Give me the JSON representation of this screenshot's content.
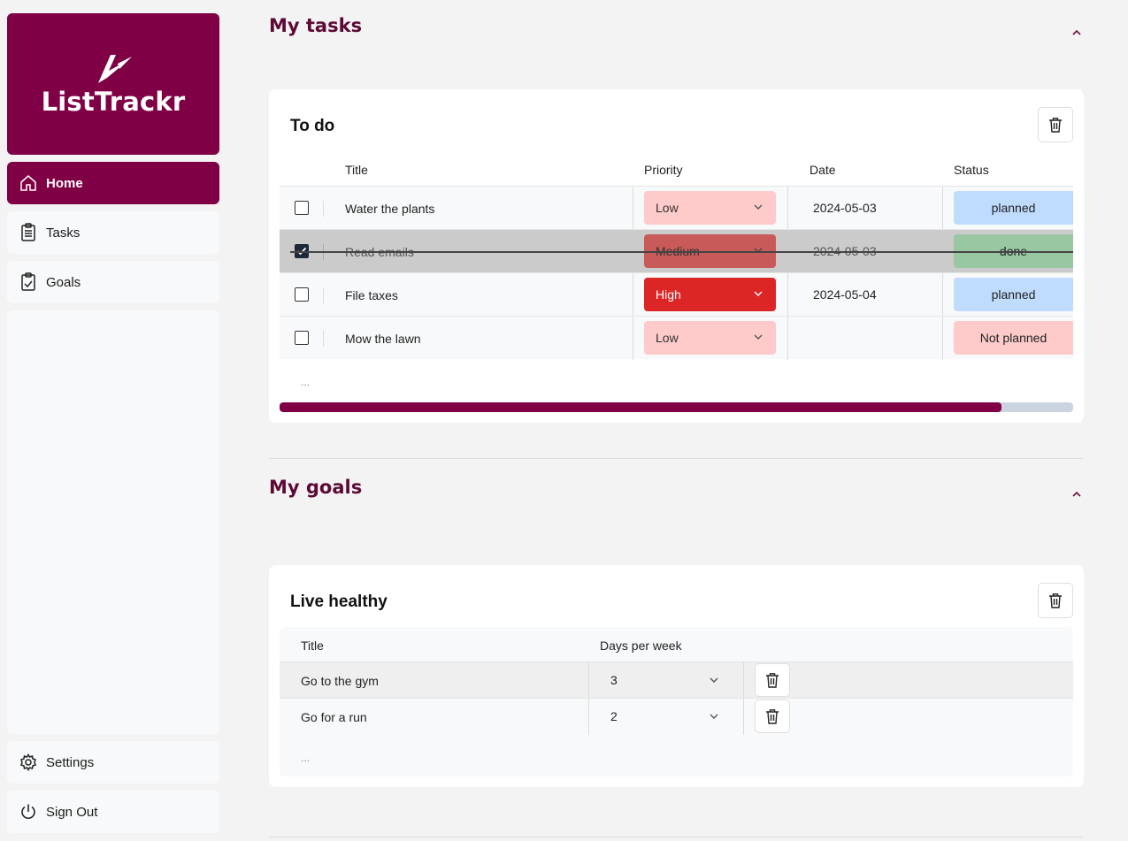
{
  "app": {
    "name": "ListTrackr"
  },
  "sidebar": {
    "items": [
      {
        "label": "Home",
        "icon": "home-icon",
        "active": true
      },
      {
        "label": "Tasks",
        "icon": "clipboard-icon",
        "active": false
      },
      {
        "label": "Goals",
        "icon": "clipboard-check-icon",
        "active": false
      }
    ],
    "bottom": [
      {
        "label": "Settings",
        "icon": "gear-icon"
      },
      {
        "label": "Sign Out",
        "icon": "power-icon"
      }
    ]
  },
  "tasks_section": {
    "title": "My tasks",
    "card": {
      "title": "To do",
      "columns": [
        "Title",
        "Priority",
        "Date",
        "Status"
      ],
      "rows": [
        {
          "checked": false,
          "title": "Water the plants",
          "priority": "Low",
          "date": "2024-05-03",
          "status": "planned"
        },
        {
          "checked": true,
          "title": "Read emails",
          "priority": "Medium",
          "date": "2024-05-03",
          "status": "done"
        },
        {
          "checked": false,
          "title": "File taxes",
          "priority": "High",
          "date": "2024-05-04",
          "status": "planned"
        },
        {
          "checked": false,
          "title": "Mow the lawn",
          "priority": "Low",
          "date": "",
          "status": "Not planned"
        }
      ],
      "more": "...",
      "progress": 0.91
    }
  },
  "goals_section": {
    "title": "My goals",
    "card": {
      "title": "Live healthy",
      "columns": [
        "Title",
        "Days per week"
      ],
      "rows": [
        {
          "title": "Go to the gym",
          "days": "3"
        },
        {
          "title": "Go for a run",
          "days": "2"
        }
      ],
      "more": "..."
    }
  },
  "colors": {
    "brand": "#800046",
    "priority_low": "#fecaca",
    "priority_medium": "#c85a5a",
    "priority_high": "#dc2626",
    "status_planned": "#bfdbfe",
    "status_done": "#98c7a2",
    "status_not_planned": "#fecaca"
  }
}
